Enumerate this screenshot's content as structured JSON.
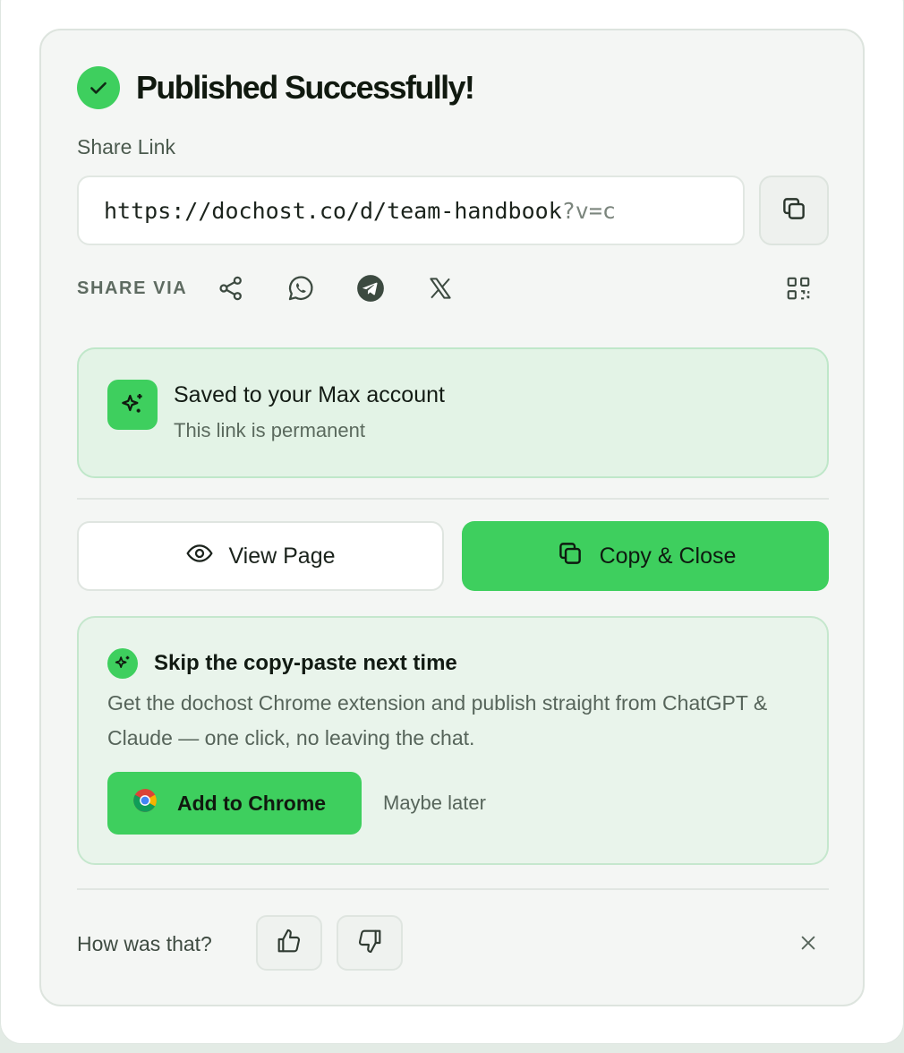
{
  "header": {
    "title": "Published Successfully!",
    "status_icon": "check-icon"
  },
  "share_link": {
    "label": "Share Link",
    "url_main": "https://dochost.co/d/team-handbook",
    "url_query": "?v=c",
    "copy_icon": "copy-icon"
  },
  "share_via": {
    "label": "SHARE VIA",
    "icons": [
      "share-icon",
      "whatsapp-icon",
      "telegram-icon",
      "x-icon",
      "qr-code-icon"
    ]
  },
  "saved": {
    "title": "Saved to your Max account",
    "subtitle": "This link is permanent",
    "icon": "sparkle-icon"
  },
  "actions": {
    "view_label": "View Page",
    "copy_close_label": "Copy & Close"
  },
  "promo": {
    "title": "Skip the copy-paste next time",
    "body": "Get the dochost Chrome extension and publish straight from ChatGPT & Claude — one click, no leaving the chat.",
    "add_label": "Add to Chrome",
    "later_label": "Maybe later"
  },
  "feedback": {
    "question": "How was that?",
    "icons": [
      "thumbs-up-icon",
      "thumbs-down-icon",
      "close-icon"
    ]
  },
  "colors": {
    "accent": "#3ecf5e",
    "card_bg": "#f4f6f4",
    "saved_bg": "#e3f3e6",
    "promo_bg": "#e9f4eb"
  }
}
